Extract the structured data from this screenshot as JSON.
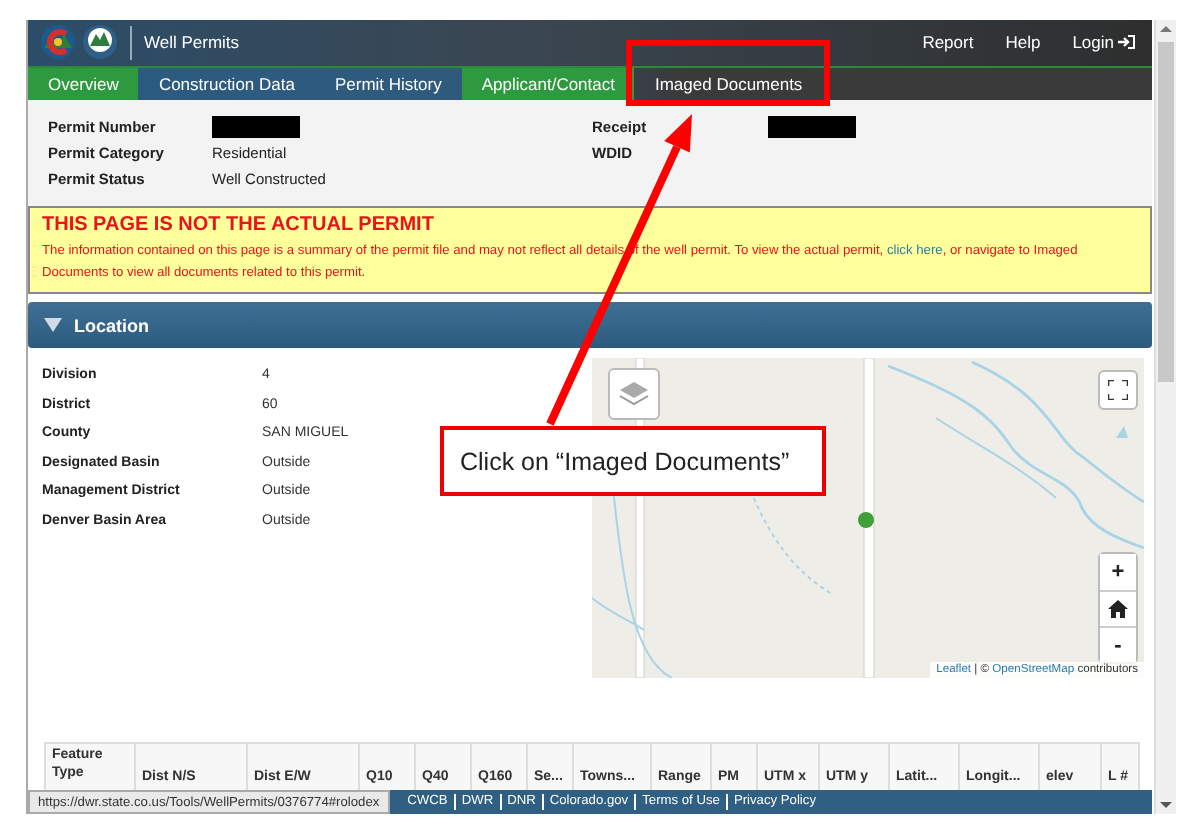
{
  "header": {
    "title": "Well Permits",
    "links": [
      "Report",
      "Help",
      "Login"
    ]
  },
  "tabs": [
    {
      "label": "Overview",
      "selected": true,
      "annotated": false
    },
    {
      "label": "Construction Data",
      "selected": false,
      "annotated": false
    },
    {
      "label": "Permit History",
      "selected": false,
      "annotated": false
    },
    {
      "label": "Applicant/Contact",
      "selected": true,
      "annotated": false
    },
    {
      "label": "Imaged Documents",
      "selected": false,
      "annotated": true
    }
  ],
  "permit": {
    "left_fields": [
      {
        "label": "Permit Number",
        "redacted": true
      },
      {
        "label": "Permit Category",
        "value": "Residential"
      },
      {
        "label": "Permit Status",
        "value": "Well Constructed"
      }
    ],
    "right_fields": [
      {
        "label": "Receipt",
        "redacted": true
      },
      {
        "label": "WDID"
      }
    ]
  },
  "notice": {
    "title": "THIS PAGE IS NOT THE ACTUAL PERMIT",
    "text_before": "The information contained on this page is a summary of the permit file and may not reflect all details of the well permit.  To view the actual permit,",
    "link": "click here",
    "text_after": ", or navigate to Imaged Documents to view all documents related to this permit."
  },
  "location": {
    "title": "Location",
    "expanded": true,
    "fields": [
      {
        "label": "Division",
        "value": "4"
      },
      {
        "label": "District",
        "value": "60"
      },
      {
        "label": "County",
        "value": "SAN MIGUEL"
      },
      {
        "label": "Designated Basin",
        "value": "Outside"
      },
      {
        "label": "Management District",
        "value": "Outside"
      },
      {
        "label": "Denver Basin Area",
        "value": "Outside"
      }
    ],
    "map": {
      "kind": "picture",
      "zoom_in": "+",
      "zoom_out": "-",
      "attribution": {
        "leaflet": "Leaflet",
        "separator": "| ©",
        "osm": "OpenStreetMap",
        "suffix": "contributors"
      }
    }
  },
  "table": {
    "columns": [
      "Feature Type",
      "Dist N/S",
      "Dist E/W",
      "Q10",
      "Q40",
      "Q160",
      "Se...",
      "Towns...",
      "Range",
      "PM",
      "UTM x",
      "UTM y",
      "Latit...",
      "Longit...",
      "elev",
      "L #"
    ]
  },
  "status_url": "https://dwr.state.co.us/Tools/WellPermits/0376774#rolodex",
  "footer_links": [
    "CWCB",
    "DWR",
    "DNR",
    "Colorado.gov",
    "Terms of Use",
    "Privacy Policy"
  ],
  "annotation": {
    "callout": "Click on “Imaged Documents”"
  }
}
